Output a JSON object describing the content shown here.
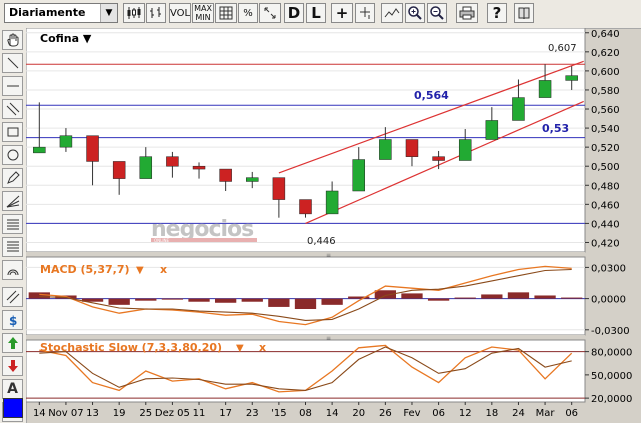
{
  "toolbar": {
    "period": "Diariamente",
    "period_arrow": "▼",
    "vol_label": "VOL",
    "max_label": "MAX",
    "min_label": "MIN",
    "percent_label": "%",
    "d_label": "D",
    "l_label": "L",
    "plus_label": "+",
    "help_label": "?"
  },
  "sidebar": {
    "text_tool_label": "A"
  },
  "main_chart": {
    "title": "Cofina ▼",
    "watermark": "negocios",
    "watermark_sub": "ONLINE",
    "high_annotation": "0,607",
    "low_annotation": "0,446",
    "level_564": "0,564",
    "level_53": "0,53",
    "y_ticks": [
      "0,420",
      "0,440",
      "0,460",
      "0,480",
      "0,500",
      "0,520",
      "0,540",
      "0,560",
      "0,580",
      "0,600",
      "0,620",
      "0,640"
    ],
    "colors": {
      "up": "#22aa33",
      "down": "#cc2222",
      "trend": "#dd3333",
      "support": "#3333bb",
      "resistance": "#cc3333"
    }
  },
  "macd_panel": {
    "title": "MACD (5,37,7)",
    "y_ticks": [
      "0,0300",
      "0,0000",
      "-0,0300"
    ]
  },
  "stoch_panel": {
    "title": "Stochastic Slow (7,3,3,80,20)",
    "y_ticks": [
      "80,0000",
      "50,0000",
      "20,0000"
    ]
  },
  "x_axis": {
    "labels": [
      "14",
      "Nov 07",
      "13",
      "19",
      "25",
      "Dez 05",
      "11",
      "17",
      "23",
      "'15",
      "08",
      "14",
      "20",
      "26",
      "Fev",
      "06",
      "12",
      "18",
      "24",
      "Mar",
      "06"
    ]
  },
  "chart_data": {
    "type": "candlestick",
    "title": "Cofina",
    "x": [
      "Out 14",
      "Nov 07",
      "Nov 13",
      "Nov 19",
      "Nov 25",
      "Dez 05",
      "Dez 11",
      "Dez 17",
      "Dez 23",
      "Jan 02",
      "Jan 08",
      "Jan 14",
      "Jan 20",
      "Jan 26",
      "Fev 02",
      "Fev 06",
      "Fev 12",
      "Fev 18",
      "Fev 24",
      "Mar 02",
      "Mar 06"
    ],
    "ylim": [
      0.41,
      0.645
    ],
    "price_close": [
      0.52,
      0.532,
      0.505,
      0.487,
      0.51,
      0.5,
      0.497,
      0.484,
      0.488,
      0.465,
      0.45,
      0.474,
      0.507,
      0.528,
      0.51,
      0.506,
      0.528,
      0.548,
      0.572,
      0.59,
      0.595
    ],
    "price_high": [
      0.567,
      0.54,
      0.515,
      0.498,
      0.52,
      0.515,
      0.504,
      0.494,
      0.494,
      0.478,
      0.462,
      0.484,
      0.52,
      0.541,
      0.522,
      0.516,
      0.539,
      0.562,
      0.591,
      0.607,
      0.605
    ],
    "price_low": [
      0.514,
      0.515,
      0.48,
      0.47,
      0.498,
      0.488,
      0.487,
      0.474,
      0.477,
      0.446,
      0.446,
      0.46,
      0.492,
      0.513,
      0.5,
      0.497,
      0.512,
      0.535,
      0.56,
      0.575,
      0.58
    ],
    "levels": [
      0.564,
      0.53,
      0.607,
      0.44
    ],
    "macd_ylim": [
      -0.035,
      0.04
    ],
    "macd_histogram": [
      0.006,
      0.003,
      -0.003,
      -0.006,
      -0.002,
      -0.001,
      -0.003,
      -0.004,
      -0.003,
      -0.008,
      -0.01,
      -0.006,
      0.002,
      0.008,
      0.005,
      -0.002,
      0.001,
      0.004,
      0.006,
      0.003,
      0.001
    ],
    "macd_line": [
      0.004,
      0.002,
      -0.008,
      -0.014,
      -0.01,
      -0.011,
      -0.013,
      -0.016,
      -0.015,
      -0.022,
      -0.025,
      -0.018,
      -0.002,
      0.012,
      0.01,
      0.008,
      0.015,
      0.022,
      0.028,
      0.031,
      0.029
    ],
    "macd_signal": [
      0.002,
      0.001,
      -0.004,
      -0.009,
      -0.01,
      -0.01,
      -0.012,
      -0.013,
      -0.014,
      -0.017,
      -0.021,
      -0.02,
      -0.01,
      0.003,
      0.008,
      0.009,
      0.012,
      0.017,
      0.022,
      0.027,
      0.028
    ],
    "stoch_ylim": [
      15,
      95
    ],
    "stoch_k": [
      82,
      75,
      40,
      30,
      55,
      42,
      45,
      32,
      40,
      28,
      30,
      55,
      85,
      88,
      60,
      40,
      72,
      86,
      82,
      45,
      78
    ],
    "stoch_d": [
      78,
      80,
      52,
      34,
      45,
      46,
      44,
      38,
      38,
      32,
      30,
      40,
      70,
      86,
      72,
      52,
      58,
      78,
      84,
      60,
      68
    ],
    "stoch_levels": [
      80,
      20
    ]
  }
}
